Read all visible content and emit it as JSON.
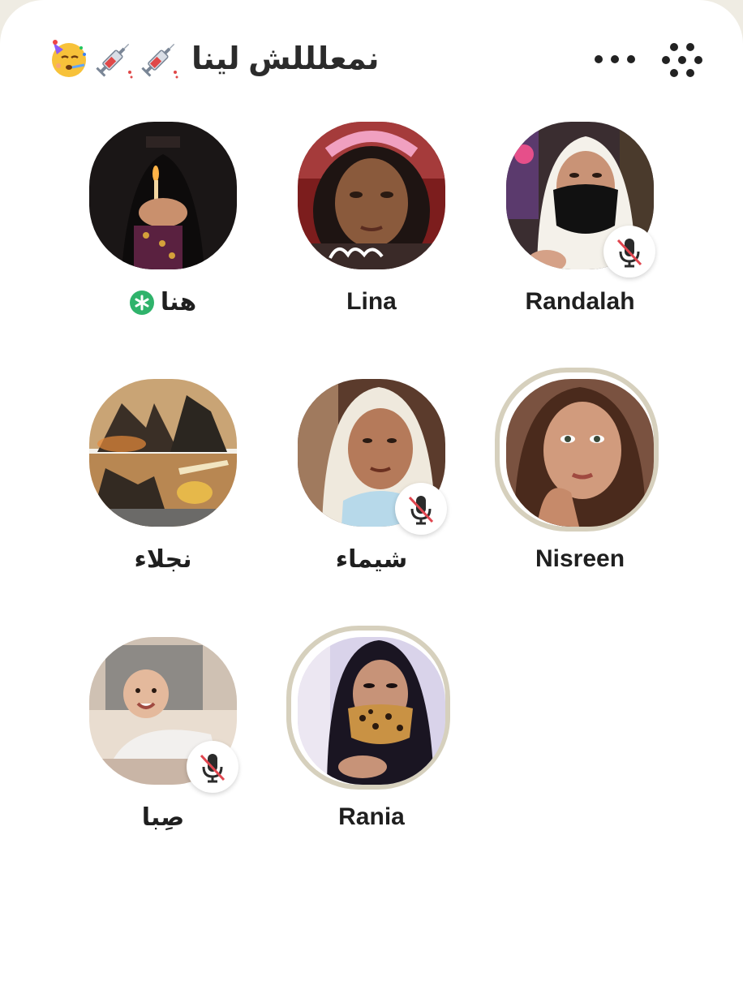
{
  "room": {
    "title": "نمعلللش لينا",
    "title_emojis": [
      "syringe-icon",
      "syringe-icon",
      "partying-face-icon"
    ]
  },
  "header_icons": {
    "more": "more-dots-icon",
    "grid": "grid-dots-icon"
  },
  "colors": {
    "background": "#ffffff",
    "outer": "#efece3",
    "speaking_ring": "#d6d0bd",
    "new_badge": "#2fb36b",
    "mute_slash": "#e0464f"
  },
  "speakers": [
    {
      "name": "هنا",
      "new_user": true,
      "muted": false,
      "speaking": false
    },
    {
      "name": "Lina",
      "muted": false,
      "speaking": false
    },
    {
      "name": "Randalah",
      "muted": true,
      "speaking": false
    },
    {
      "name": "نجلاء",
      "muted": false,
      "speaking": false
    },
    {
      "name": "شيماء",
      "muted": true,
      "speaking": false
    },
    {
      "name": "Nisreen",
      "muted": false,
      "speaking": true
    },
    {
      "name": "صِبا",
      "muted": true,
      "speaking": false
    },
    {
      "name": "Rania",
      "muted": false,
      "speaking": true
    }
  ]
}
